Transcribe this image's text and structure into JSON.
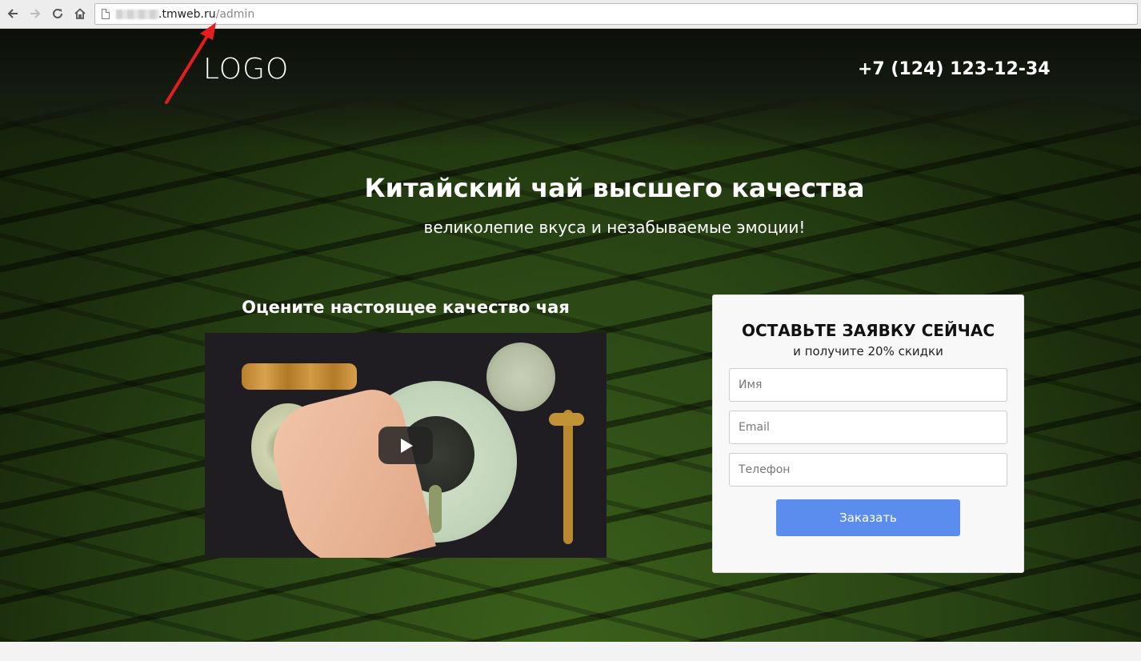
{
  "browser": {
    "url_host": ".tmweb.ru",
    "url_path": "/admin",
    "back_icon": "arrow-left-icon",
    "forward_icon": "arrow-right-icon",
    "reload_icon": "reload-icon",
    "home_icon": "home-icon"
  },
  "header": {
    "logo": "LOGO",
    "phone": "+7 (124) 123-12-34"
  },
  "hero": {
    "title": "Китайский чай высшего качества",
    "subtitle": "великолепие вкуса и незабываемые эмоции!"
  },
  "video": {
    "heading": "Оцените настоящее качество чая",
    "play_icon": "play-icon"
  },
  "form": {
    "title": "ОСТАВЬТЕ ЗАЯВКУ СЕЙЧАС",
    "subtitle": "и получите 20% скидки",
    "name_placeholder": "Имя",
    "email_placeholder": "Email",
    "phone_placeholder": "Телефон",
    "submit_label": "Заказать"
  },
  "colors": {
    "accent": "#5b8def",
    "arrow": "#e41e1e"
  }
}
